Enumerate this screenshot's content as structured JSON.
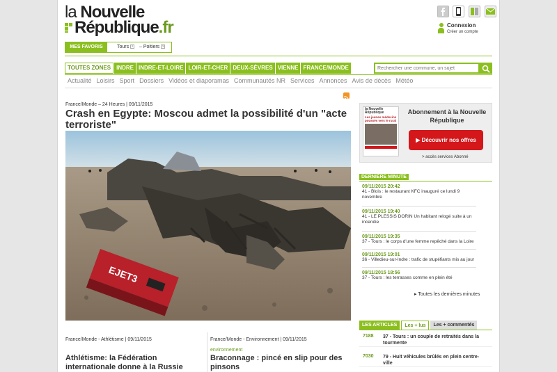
{
  "header": {
    "logo_line1_a": "la",
    "logo_line1_b": "Nouvelle",
    "logo_line2_a": "République",
    "logo_line2_b": ".fr",
    "social_icons": [
      "facebook-icon",
      "mobile-icon",
      "newsstand-icon",
      "newsletter-icon"
    ],
    "connexion_label": "Connexion",
    "connexion_sub": "Créer un compte"
  },
  "favoris": {
    "label": "MES FAVORIS",
    "items": [
      {
        "label": "Tours",
        "remove": "x"
      },
      {
        "label": "– Poitiers",
        "remove": "x"
      }
    ]
  },
  "zones": [
    "TOUTES ZONES",
    "INDRE",
    "INDRE-ET-LOIRE",
    "LOIR-ET-CHER",
    "DEUX-SÈVRES",
    "VIENNE",
    "FRANCE/MONDE"
  ],
  "search": {
    "placeholder": "Rechercher une commune, un sujet"
  },
  "subnav": [
    "Actualité",
    "Loisirs",
    "Sport",
    "Dossiers",
    "Vidéos et diaporamas",
    "Communautés NR",
    "Services",
    "Annonces",
    "Avis de décès",
    "Météo"
  ],
  "main_article": {
    "meta": "France/Monde –   24 Heures  |  09/11/2015",
    "title": "Crash en Egypte: Moscou admet la possibilité d'un \"acte terroriste\"",
    "photo_text": "EJET3"
  },
  "bottom_articles": [
    {
      "meta": "France/Monde  -    Athlétisme  |  09/11/2015",
      "tag": "",
      "title": "Athlétisme: la Fédération internationale donne à la Russie"
    },
    {
      "meta": "France/Monde  -    Environnement  |  09/11/2015",
      "tag": "environnement",
      "title": "Braconnage : pincé en slip pour des pinsons"
    }
  ],
  "abonnement": {
    "thumb_title": "la Nouvelle République",
    "thumb_headline": "Les jeunes médecins poussés vers le rural",
    "title": "Abonnement à la Nouvelle République",
    "button": "▶ Découvrir nos offres",
    "link": "> accès services Abonné"
  },
  "derniere_minute": {
    "label": "DERNIÈRE MINUTE",
    "items": [
      {
        "time": "09/11/2015 20:42",
        "text": "41 -  Blois : le restaurant KFC inauguré ce lundi 9 novembre"
      },
      {
        "time": "09/11/2015 19:40",
        "text": "41 -  LE PLESSIS DORIN Un habitant relogé suite à un incendie"
      },
      {
        "time": "09/11/2015 19:35",
        "text": "37 -  Tours : le corps d'une femme repêché dans la Loire"
      },
      {
        "time": "09/11/2015 19:01",
        "text": "36 -  Villedieu-sur-Indre : trafic de stupéfiants mis au jour"
      },
      {
        "time": "09/11/2015 18:56",
        "text": "37 -  Tours : les terrasses comme en plein été"
      }
    ],
    "all_link": "▸ Toutes les dernières minutes"
  },
  "les_articles": {
    "tabs": [
      "LES ARTICLES",
      "Les + lus",
      "Les + commentés"
    ],
    "rows": [
      {
        "count": "7188",
        "text": "37 -  Tours : un couple de retraités dans la tourmente"
      },
      {
        "count": "7030",
        "text": "79 -  Huit véhicules brûlés en plein centre-ville"
      }
    ]
  },
  "colors": {
    "brand_green": "#8bbf1f",
    "accent_red": "#d3171b",
    "rss_orange": "#f29423"
  }
}
